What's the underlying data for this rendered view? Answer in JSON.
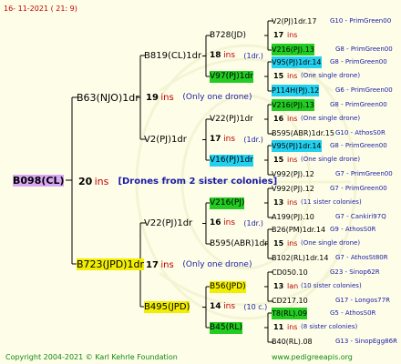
{
  "date": "16-  11-2021  (  21:   9)",
  "footer_left": "Copyright 2004-2021 © Karl Kehrle Foundation",
  "footer_right": "www.pedigreeapis.org",
  "colors": {
    "background": "#fefee8",
    "line": "#000000",
    "root_box": "#d9a8f5",
    "green": "#22cc22",
    "cyan": "#22d0f0",
    "yellow": "#f2ee00",
    "red": "#c00000",
    "blue": "#1a1aa8"
  },
  "nodes": {
    "root": {
      "label": "B098(CL)",
      "ins_count": "20",
      "ins_word": "ins",
      "note": "[Drones from 2 sister colonies]"
    },
    "p1": {
      "label": "B63(NJO)1dr",
      "ins_count": "19",
      "ins_word": "ins",
      "note": "(Only one drone)"
    },
    "p2": {
      "label": "B723(JPD)1dr",
      "ins_count": "17",
      "ins_word": "ins",
      "note": "(Only one drone)"
    },
    "g1": {
      "label": "B819(CL)1dr",
      "ins_count": "18",
      "ins_word": "ins",
      "note": "(1dr.)"
    },
    "g2": {
      "label": "V2(PJ)1dr",
      "ins_count": "17",
      "ins_word": "ins",
      "note": "(1dr.)"
    },
    "g3": {
      "label": "V22(PJ)1dr",
      "ins_count": "16",
      "ins_word": "ins",
      "note": "(1dr.)"
    },
    "g4": {
      "label": "B495(JPD)",
      "ins_count": "14",
      "ins_word": "ins",
      "note": "(10 c.)"
    },
    "gg1": {
      "label": "B728(JD)"
    },
    "gg2": {
      "label": "V97(PJ)1dr"
    },
    "gg3": {
      "label": "V22(PJ)1dr"
    },
    "gg4": {
      "label": "V16(PJ)1dr"
    },
    "gg5": {
      "label": "V216(PJ)"
    },
    "gg6": {
      "label": "B595(ABR)1dr"
    },
    "gg7": {
      "label": "B56(JPD)"
    },
    "gg8": {
      "label": "B45(RL)"
    }
  },
  "right_entries": [
    {
      "a": "V2(PJ)1dr.17",
      "b": "G10 - PrimGreen00",
      "ins_count": "17",
      "ins_word": "ins",
      "ins_note": "",
      "c": "V216(PJ).13",
      "d": "G8 - PrimGreen00"
    },
    {
      "a": "V95(PJ)1dr.14",
      "b": "G8 - PrimGreen00",
      "ins_count": "15",
      "ins_word": "ins",
      "ins_note": "(One single drone)",
      "c": "P114H(PJ).12",
      "d": "G6 - PrimGreen00"
    },
    {
      "a": "V216(PJ).13",
      "b": "G8 - PrimGreen00",
      "ins_count": "16",
      "ins_word": "ins",
      "ins_note": "(One single drone)",
      "c": "B595(ABR)1dr.15",
      "d": "G10 - AthosS0R"
    },
    {
      "a": "V95(PJ)1dr.14",
      "b": "G8 - PrimGreen00",
      "ins_count": "15",
      "ins_word": "ins",
      "ins_note": "(One single drone)",
      "c": "V992(PJ).12",
      "d": "G7 - PrimGreen00"
    },
    {
      "a": "V992(PJ).12",
      "b": "G7 - PrimGreen00",
      "ins_count": "13",
      "ins_word": "ins",
      "ins_note": "(11 sister colonies)",
      "c": "A199(PJ).10",
      "d": "G7 - Cankiri97Q"
    },
    {
      "a": "B26(PM)1dr.14",
      "b": "G9 - AthosS0R",
      "ins_count": "15",
      "ins_word": "ins",
      "ins_note": "(One single drone)",
      "c": "B102(RL)1dr.14",
      "d": "G7 - AthosSt80R"
    },
    {
      "a": "CD050.10",
      "b": "G23 - Sinop62R",
      "ins_count": "13",
      "ins_word": "lan",
      "ins_note": "(10 sister colonies)",
      "c": "CD217.10",
      "d": "G17 - Longos77R"
    },
    {
      "a": "T8(RL).09",
      "b": "G5 - AthosS0R",
      "ins_count": "11",
      "ins_word": "ins",
      "ins_note": "(8 sister colonies)",
      "c": "B40(RL).08",
      "d": "G13 - SinopEgg86R"
    }
  ]
}
